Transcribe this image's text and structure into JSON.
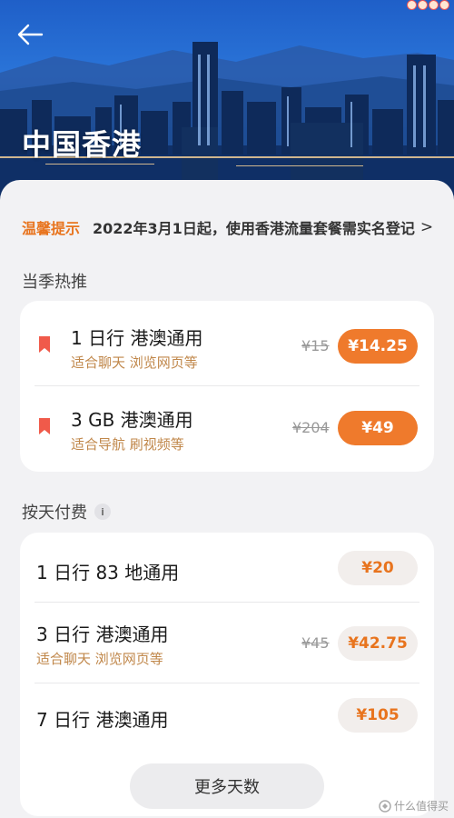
{
  "header": {
    "title": "中国香港",
    "back_icon": "arrow-left-icon"
  },
  "notice": {
    "tag": "温馨提示",
    "text": "2022年3月1日起，使用香港流量套餐需实名登记",
    "chevron": ">"
  },
  "featured": {
    "section_title": "当季热推",
    "items": [
      {
        "title": "1 日行  港澳通用",
        "subtitle": "适合聊天 浏览网页等",
        "old_price": "¥15",
        "price": "¥14.25"
      },
      {
        "title": "3 GB 港澳通用",
        "subtitle": "适合导航 刷视频等",
        "old_price": "¥204",
        "price": "¥49"
      }
    ]
  },
  "daily": {
    "section_title": "按天付费",
    "info_icon": "i",
    "items": [
      {
        "title": "1 日行  83 地通用",
        "subtitle": "",
        "old_price": "",
        "price": "¥20"
      },
      {
        "title": "3 日行  港澳通用",
        "subtitle": "适合聊天 浏览网页等",
        "old_price": "¥45",
        "price": "¥42.75"
      },
      {
        "title": "7 日行  港澳通用",
        "subtitle": "",
        "old_price": "",
        "price": "¥105"
      }
    ]
  },
  "more_button": "更多天数",
  "watermark": "什么值得买",
  "colors": {
    "accent": "#ef7a2c",
    "accent_text": "#e8741e",
    "subtitle": "#c0874a",
    "background": "#f2f2f4"
  }
}
